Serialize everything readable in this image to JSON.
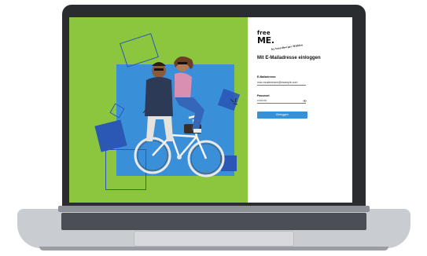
{
  "colors": {
    "hero_green": "#8cc63f",
    "hero_blue": "#3a8fd9",
    "accent_navy": "#2b57b5",
    "button_blue": "#3592d8"
  },
  "brand": {
    "line1": "free",
    "line2": "ME.",
    "tagline": "by Vorarlberger Mühlen"
  },
  "login": {
    "heading": "Mit E-Mailadresse einloggen",
    "email_label": "E-Mailadresse",
    "email_value": "max.mustermann@example.com",
    "password_label": "Passwort",
    "password_value": "••••••••••",
    "password_toggle_icon": "eye-icon",
    "submit_label": "Einloggen"
  }
}
